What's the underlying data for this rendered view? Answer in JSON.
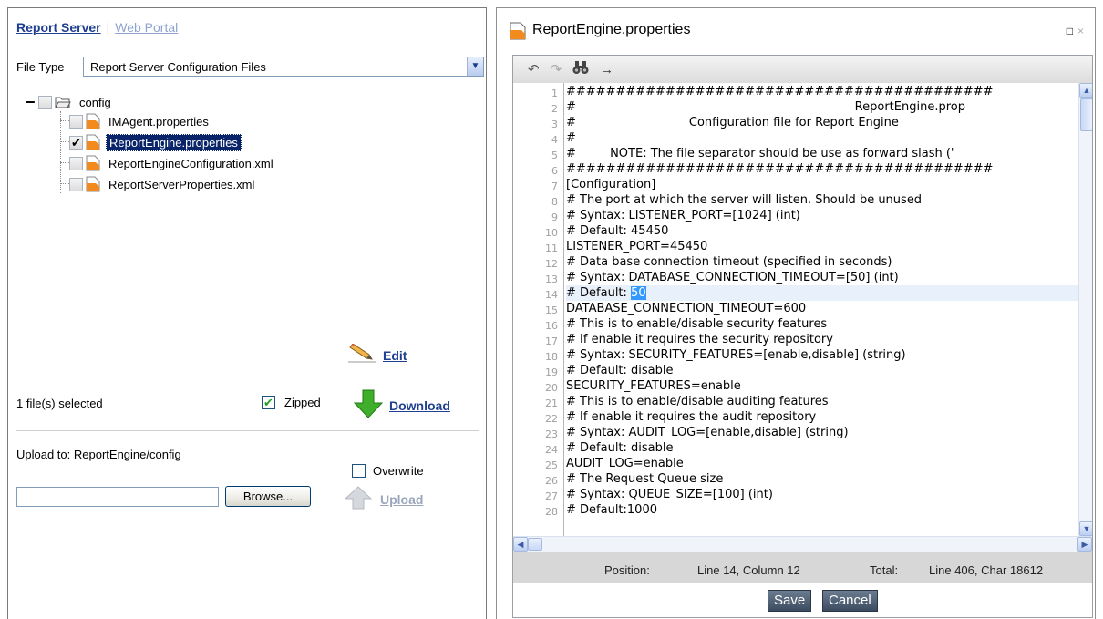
{
  "left": {
    "tabs": {
      "active": "Report Server",
      "separator": "|",
      "inactive": "Web Portal"
    },
    "file_type": {
      "label": "File Type",
      "selected": "Report Server Configuration Files"
    },
    "tree": {
      "root": "config",
      "items": [
        {
          "label": "IMAgent.properties",
          "checked": false,
          "selected": false
        },
        {
          "label": "ReportEngine.properties",
          "checked": true,
          "selected": true
        },
        {
          "label": "ReportEngineConfiguration.xml",
          "checked": false,
          "selected": false
        },
        {
          "label": "ReportServerProperties.xml",
          "checked": false,
          "selected": false
        }
      ]
    },
    "edit_label": "Edit",
    "selected_count": "1 file(s) selected",
    "zipped": {
      "label": "Zipped",
      "checked": true
    },
    "download_label": "Download",
    "upload_to": "Upload to: ReportEngine/config",
    "overwrite": {
      "label": "Overwrite",
      "checked": false
    },
    "browse_label": "Browse...",
    "upload_label": "Upload"
  },
  "editor": {
    "title": "ReportEngine.properties",
    "window_buttons": {
      "minimize": "_",
      "maximize": "□",
      "close": "×"
    },
    "toolbar": {
      "undo": "↶",
      "redo": "↷",
      "find": "🔍",
      "goto": "→"
    },
    "lines": [
      "###########################################",
      "#                                                                          ReportEngine.prop",
      "#                              Configuration file for Report Engine",
      "#",
      "#         NOTE: The file separator should be use as forward slash ('",
      "###########################################",
      "[Configuration]",
      "# The port at which the server will listen. Should be unused",
      "# Syntax: LISTENER_PORT=[1024] (int)",
      "# Default: 45450",
      "LISTENER_PORT=45450",
      "# Data base connection timeout (specified in seconds)",
      "# Syntax: DATABASE_CONNECTION_TIMEOUT=[50] (int)",
      "# Default: 50",
      "DATABASE_CONNECTION_TIMEOUT=600",
      "# This is to enable/disable security features",
      "# If enable it requires the security repository",
      "# Syntax: SECURITY_FEATURES=[enable,disable] (string)",
      "# Default: disable",
      "SECURITY_FEATURES=enable",
      "# This is to enable/disable auditing features",
      "# If enable it requires the audit repository",
      "# Syntax: AUDIT_LOG=[enable,disable] (string)",
      "# Default: disable",
      "AUDIT_LOG=enable",
      "# The Request Queue size",
      "# Syntax: QUEUE_SIZE=[100] (int)",
      "# Default:1000"
    ],
    "line_numbers": [
      "1",
      "2",
      "3",
      "4",
      "5",
      "6",
      "7",
      "8",
      "9",
      "10",
      "11",
      "12",
      "13",
      "14",
      "15",
      "16",
      "17",
      "18",
      "19",
      "20",
      "21",
      "22",
      "23",
      "24",
      "25",
      "26",
      "27",
      "28"
    ],
    "current_line": 14,
    "current_line_prefix": "# Default: ",
    "current_line_selected": "50",
    "status": {
      "position_label": "Position:",
      "position_value": "Line 14, Column 12",
      "total_label": "Total:",
      "total_value": "Line 406, Char 18612"
    },
    "save_label": "Save",
    "cancel_label": "Cancel"
  },
  "colors": {
    "link": "#1f3f8f",
    "selection": "#0a246a",
    "text_highlight": "#3399ff",
    "dark_button": "#4b5b6e"
  }
}
